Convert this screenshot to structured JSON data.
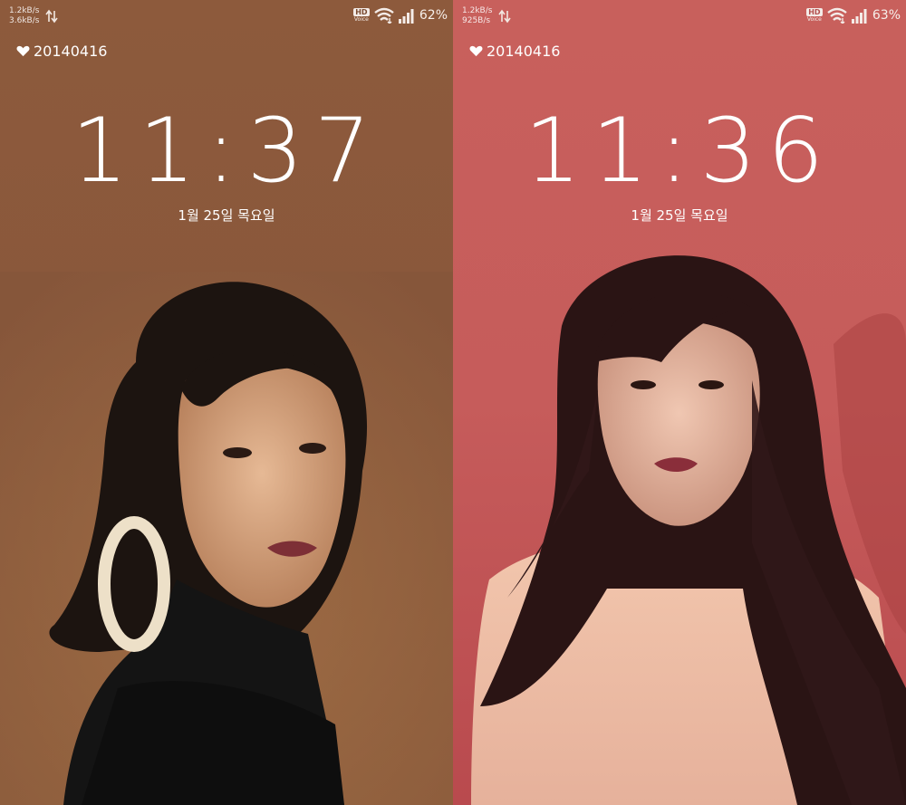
{
  "screens": [
    {
      "netspeed_up": "1.2kB/s",
      "netspeed_down": "3.6kB/s",
      "hd_label": "HD",
      "voice_label": "Voice",
      "battery": "62%",
      "favorite_text": "20140416",
      "time": "11:37",
      "date": "1월 25일 목요일"
    },
    {
      "netspeed_up": "1.2kB/s",
      "netspeed_down": "925B/s",
      "hd_label": "HD",
      "voice_label": "Voice",
      "battery": "63%",
      "favorite_text": "20140416",
      "time": "11:36",
      "date": "1월 25일 목요일"
    }
  ],
  "icons": {
    "heart": "heart-icon",
    "wifi": "wifi-icon",
    "signal": "signal-icon",
    "data_arrows": "data-transfer-icon"
  },
  "colors": {
    "left_background": "#8d5a3c",
    "right_background": "#c8605c",
    "text": "#ffffff"
  }
}
